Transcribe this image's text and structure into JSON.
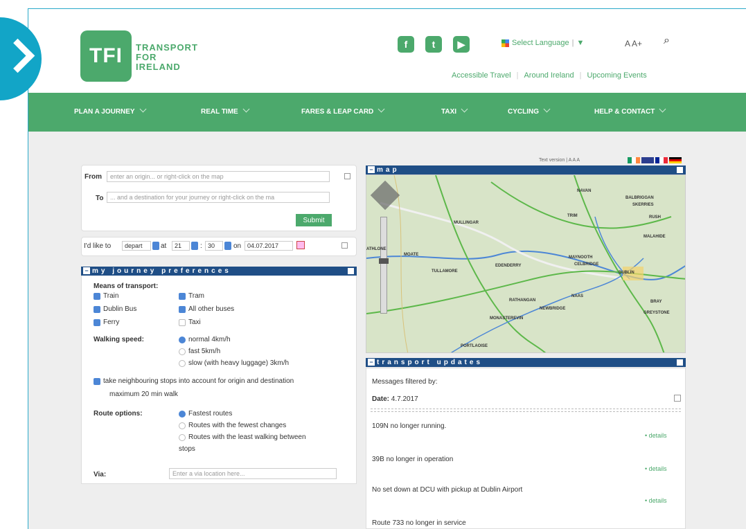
{
  "header": {
    "logo_abbr": "TFI",
    "logo_lines": [
      "TRANSPORT",
      "FOR",
      "IRELAND"
    ],
    "social": [
      {
        "name": "facebook-icon",
        "glyph": "f"
      },
      {
        "name": "twitter-icon",
        "glyph": "t"
      },
      {
        "name": "youtube-icon",
        "glyph": "▶"
      }
    ],
    "language": "Select Language",
    "language_arrow": "▼",
    "text_size": "A A+",
    "search_glyph": "⌕",
    "top_links": [
      "Accessible Travel",
      "Around Ireland",
      "Upcoming Events"
    ]
  },
  "nav": [
    "PLAN A JOURNEY",
    "REAL TIME",
    "FARES & LEAP CARD",
    "TAXI",
    "CYCLING",
    "HELP & CONTACT"
  ],
  "planner": {
    "from_label": "From",
    "from_placeholder": "enter an origin... or right-click on the map",
    "to_label": "To",
    "to_placeholder": "... and a destination for your journey or right-click on the ma",
    "submit": "Submit",
    "id_like_to": "I'd like to",
    "mode_value": "depart",
    "at_label": "at",
    "hour": "21",
    "minute": "30",
    "on_label": "on",
    "date": "04.07.2017",
    "text_version": "Text version | A A A"
  },
  "preferences": {
    "title": "my journey preferences",
    "means_label": "Means of transport:",
    "means": [
      {
        "label": "Train",
        "checked": true
      },
      {
        "label": "Tram",
        "checked": true
      },
      {
        "label": "Dublin Bus",
        "checked": true
      },
      {
        "label": "All other buses",
        "checked": true
      },
      {
        "label": "Ferry",
        "checked": true
      },
      {
        "label": "Taxi",
        "checked": false
      }
    ],
    "walking_label": "Walking speed:",
    "walking": [
      {
        "label": "normal 4km/h",
        "selected": true
      },
      {
        "label": "fast 5km/h",
        "selected": false
      },
      {
        "label": "slow (with heavy luggage) 3km/h",
        "selected": false
      }
    ],
    "neighbouring": "take neighbouring stops into account for origin and destination",
    "maximum": "maximum 20 min walk",
    "route_label": "Route options:",
    "routes": [
      {
        "label": "Fastest routes",
        "selected": true
      },
      {
        "label": "Routes with the fewest changes",
        "selected": false
      },
      {
        "label": "Routes with the least walking between",
        "selected": false
      }
    ],
    "route_cont": "stops",
    "via_label": "Via:",
    "via_placeholder": "Enter a via location here..."
  },
  "map": {
    "title": "map",
    "places": [
      "NAVAN",
      "BALBRIGGAN",
      "SKERRIES",
      "RUSH",
      "TRIM",
      "MULLINGAR",
      "MALAHIDE",
      "ATHLONE",
      "MOATE",
      "MAYNOOTH",
      "CELBRIDGE",
      "DUBLIN",
      "EDENDERRY",
      "TULLAMORE",
      "NAAS",
      "BRAY",
      "RATHANGAN",
      "NEWBRIDGE",
      "GREYSTONE",
      "MONASTEREVIN",
      "PORTLAOISE"
    ]
  },
  "updates": {
    "title": "transport updates",
    "filtered": "Messages filtered by:",
    "date_label": "Date:",
    "date": "4.7.2017",
    "items": [
      {
        "text": "109N no longer running.",
        "link": "• details"
      },
      {
        "text": "39B no longer in operation",
        "link": "• details"
      },
      {
        "text": "No set down at DCU with pickup at Dublin Airport",
        "link": "• details"
      },
      {
        "text": "Route 733 no longer in service",
        "link": ""
      }
    ]
  },
  "colors": {
    "brand_green": "#4ca96c",
    "bar_blue": "#1f4e86",
    "accent_teal": "#12a5c7"
  }
}
